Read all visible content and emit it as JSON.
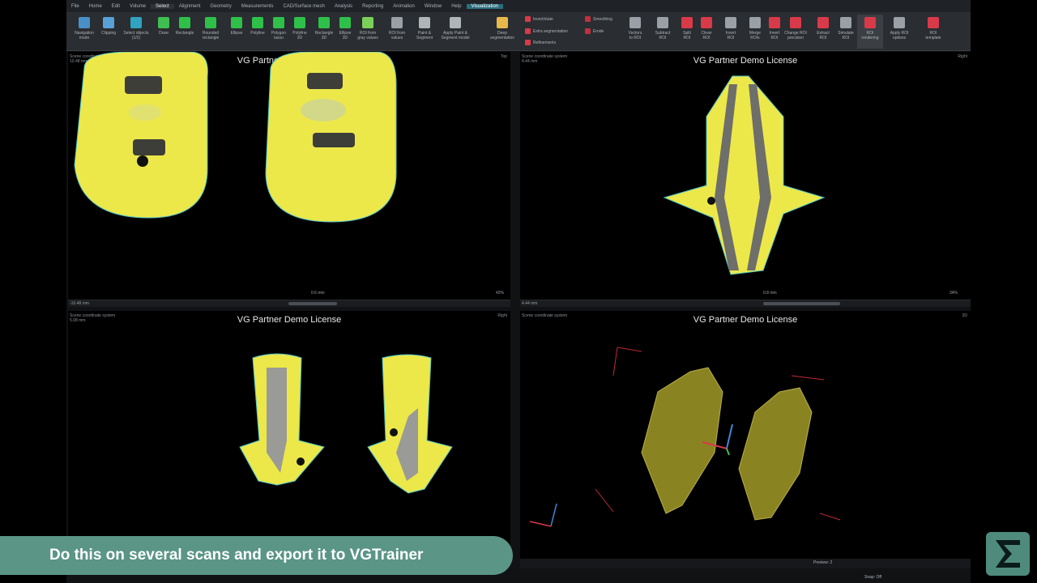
{
  "menu": [
    "File",
    "Home",
    "Edit",
    "Volume",
    "Select",
    "Alignment",
    "Geometry",
    "Measurements",
    "CAD/Surface mesh",
    "Analysis",
    "Reporting",
    "Animation",
    "Window",
    "Help",
    "Visualization"
  ],
  "ribbon_tools": [
    {
      "label": "Navigation\nmode",
      "color": "#4a90c8"
    },
    {
      "label": "Clipping",
      "color": "#5aa0d8"
    },
    {
      "label": "Select objects\n(1/2)",
      "color": "#2fa3c0"
    },
    {
      "label": "Draw",
      "color": "#3fbf4f"
    },
    {
      "label": "Rectangle",
      "color": "#2fc04a"
    },
    {
      "label": "Rounded\nrectangle",
      "color": "#2fc04a"
    },
    {
      "label": "Ellipse",
      "color": "#2fc04a"
    },
    {
      "label": "Polyline",
      "color": "#2fc04a"
    },
    {
      "label": "Polygon\nlasso",
      "color": "#2fc04a"
    },
    {
      "label": "Polyline\n3D",
      "color": "#2fc04a"
    },
    {
      "label": "Rectangle\n3D",
      "color": "#2fc04a"
    },
    {
      "label": "Ellipse\n3D",
      "color": "#2fc04a"
    },
    {
      "label": "ROI from\ngray values",
      "color": "#7bd05a"
    },
    {
      "label": "ROI from\nvalues",
      "color": "#9aa0a6"
    },
    {
      "label": "Paint &\nSegment",
      "color": "#b0b5ba"
    },
    {
      "label": "Apply Paint &\nSegment model",
      "color": "#b0b5ba"
    },
    {
      "label": "Deep\nsegmentation",
      "color": "#e8b84a"
    }
  ],
  "ribbon_small": [
    "Invert/state",
    "Extra segmentation",
    "Refinements",
    "Smoothing",
    "Erode"
  ],
  "ribbon_tools_right": [
    {
      "label": "Vectors\nto ROI",
      "color": "#9aa0a6"
    },
    {
      "label": "Subtract\nROI",
      "color": "#9aa0a6"
    },
    {
      "label": "Split\nROI",
      "color": "#d83a4a"
    },
    {
      "label": "Clean\nROI",
      "color": "#d83a4a"
    },
    {
      "label": "Invert\nROI",
      "color": "#9aa0a6"
    },
    {
      "label": "Merge\nROIs",
      "color": "#9aa0a6"
    },
    {
      "label": "Invert\nROI",
      "color": "#d83a4a"
    },
    {
      "label": "Change ROI\nprecision",
      "color": "#d83a4a"
    },
    {
      "label": "Extract\nROI",
      "color": "#d83a4a"
    },
    {
      "label": "Simulate\nROI",
      "color": "#9aa0a6"
    },
    {
      "label": "ROI\nrendering",
      "color": "#d83a4a"
    },
    {
      "label": "Apply ROI\noptions",
      "color": "#9aa0a6"
    },
    {
      "label": "ROI\ntemplate",
      "color": "#d83a4a"
    }
  ],
  "viewports": {
    "tl": {
      "header": "Scene coordinate system\n10.48 mm",
      "watermark": "VG Partner Demo License",
      "corner": "Top",
      "zoom": "-10.48 mm",
      "scale": "0.6 mm",
      "pct": "42%"
    },
    "tr": {
      "header": "Scene coordinate system\n4.44 mm",
      "watermark": "VG Partner Demo License",
      "corner": "Right",
      "zoom": "4.44 mm",
      "scale": "0.8 mm",
      "pct": "34%"
    },
    "bl": {
      "header": "Scene coordinate system\n5.08 mm",
      "watermark": "VG Partner Demo License",
      "corner": "Right",
      "zoom": "",
      "scale": "",
      "pct": ""
    },
    "br": {
      "header": "Scene coordinate system",
      "watermark": "VG Partner Demo License",
      "corner": "3D",
      "zoom": "",
      "scale": "",
      "pct": ""
    }
  },
  "caption": "Do this on several scans and export it to VGTrainer",
  "status": {
    "preview": "Preview: 2",
    "info": "Snap: Off"
  },
  "colors": {
    "segmentation": "#ece84a",
    "accent": "#2b6f7e",
    "caption_bg": "#5a9585"
  }
}
